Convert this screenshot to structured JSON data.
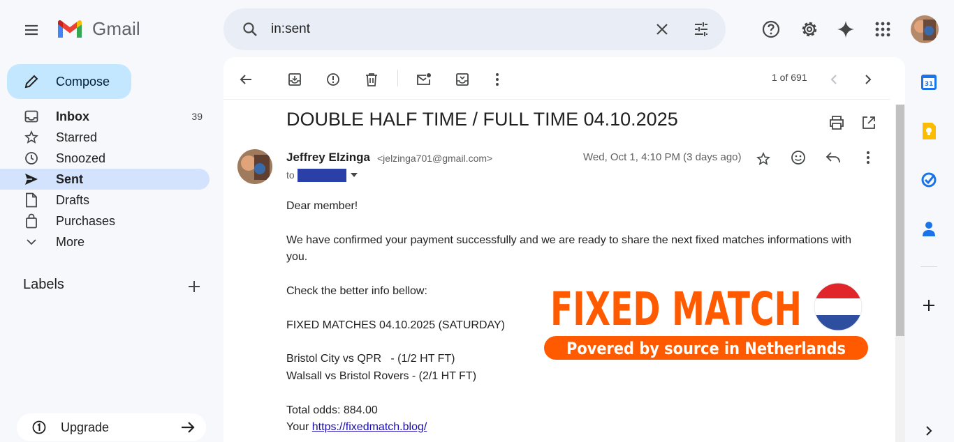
{
  "app": {
    "name": "Gmail"
  },
  "search": {
    "query": "in:sent"
  },
  "sidebar": {
    "compose_label": "Compose",
    "items": [
      {
        "label": "Inbox",
        "count": "39"
      },
      {
        "label": "Starred",
        "count": ""
      },
      {
        "label": "Snoozed",
        "count": ""
      },
      {
        "label": "Sent",
        "count": ""
      },
      {
        "label": "Drafts",
        "count": ""
      },
      {
        "label": "Purchases",
        "count": ""
      },
      {
        "label": "More",
        "count": ""
      }
    ],
    "active_item": "Sent",
    "labels_header": "Labels",
    "upgrade_label": "Upgrade"
  },
  "toolbar": {
    "pager": "1 of 691"
  },
  "email": {
    "subject": "DOUBLE HALF TIME / FULL TIME 04.10.2025",
    "sender_name": "Jeffrey Elzinga",
    "sender_email": "<jelzinga701@gmail.com>",
    "date": "Wed, Oct 1, 4:10 PM (3 days ago)",
    "to_label": "to",
    "body": {
      "greeting": "Dear member!",
      "line1a": "We have confirmed your payment successfully and we are ready to share the next fixed matches informations with",
      "line1b": "you.",
      "line2": "Check the better info bellow:",
      "line3": "FIXED MATCHES 04.10.2025 (SATURDAY)",
      "match1": "Bristol City vs QPR   - (1/2 HT FT)",
      "match2": "Walsall vs Bristol Rovers - (2/1 HT FT)",
      "odds": "Total odds: 884.00",
      "link_prefix": "Your ",
      "link_text": "https://fixedmatch.blog/"
    },
    "banner": {
      "title": "FIXED MATCH",
      "subtitle": "Povered by source in Netherlands"
    }
  },
  "colors": {
    "compose_bg": "#c2e7ff",
    "active_nav_bg": "#d3e3fd",
    "banner_orange": "#ff5a00",
    "app_bg": "#f6f8fc"
  }
}
